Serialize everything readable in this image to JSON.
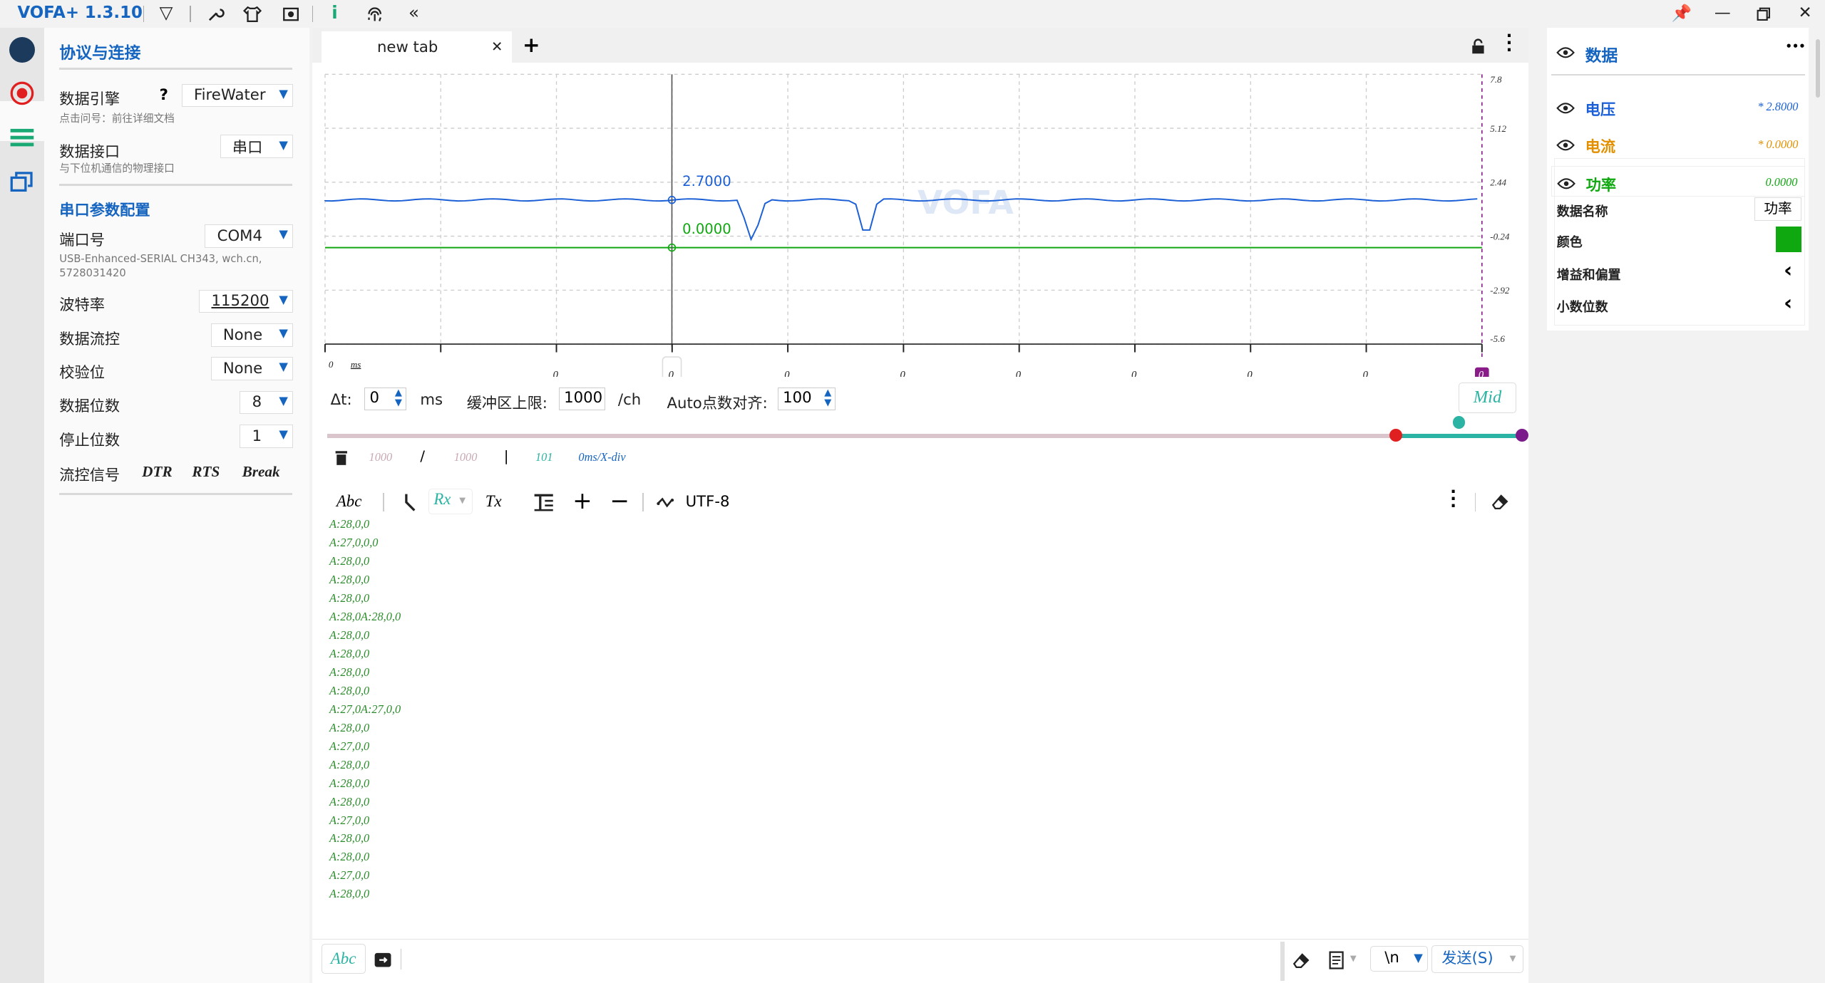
{
  "app": {
    "title": "VOFA+ 1.3.10"
  },
  "config": {
    "header": "协议与连接",
    "engine_label": "数据引擎",
    "engine_help": "?",
    "engine_value": "FireWater",
    "engine_hint": "点击问号：前往详细文档",
    "iface_label": "数据接口",
    "iface_value": "串口",
    "iface_hint": "与下位机通信的物理接口",
    "serial_section": "串口参数配置",
    "port_label": "端口号",
    "port_value": "COM4",
    "port_desc_1": "USB-Enhanced-SERIAL CH343, wch.cn,",
    "port_desc_2": "5728031420",
    "baud_label": "波特率",
    "baud_value": "115200",
    "flow_label": "数据流控",
    "flow_value": "None",
    "parity_label": "校验位",
    "parity_value": "None",
    "databits_label": "数据位数",
    "databits_value": "8",
    "stopbits_label": "停止位数",
    "stopbits_value": "1",
    "signal_label": "流控信号",
    "dtr": "DTR",
    "rts": "RTS",
    "break": "Break"
  },
  "tabs": {
    "active": "new tab",
    "close": "✕",
    "add": "+"
  },
  "plot": {
    "y_ticks": [
      "7.8",
      "5.12",
      "2.44",
      "-0.24",
      "-2.92",
      "-5.6"
    ],
    "x_origin": "0",
    "x_unit": "ms",
    "x_labels": [
      "0",
      "0",
      "0",
      "0",
      "0",
      "0",
      "0",
      "0",
      "0"
    ],
    "x_sub": "0",
    "cursor_value": "0",
    "marker_label": "0",
    "cursor_blue_value": "2.7000",
    "cursor_green_value": "0.0000",
    "watermark": "VOFA",
    "series_colors": {
      "voltage": "#1a5fd6",
      "current": "#e29000",
      "power": "#10a810"
    }
  },
  "controls": {
    "dt_label": "Δt:",
    "dt_value": "0",
    "dt_unit": "ms",
    "buffer_label": "缓冲区上限:",
    "buffer_value": "1000",
    "buffer_unit": "/ch",
    "auto_label": "Auto点数对齐:",
    "auto_value": "100",
    "mid_label": "Mid"
  },
  "status": {
    "count_a": "1000",
    "slash": "/",
    "count_b": "1000",
    "bar": "|",
    "count_c": "101",
    "div": "0ms/X-div"
  },
  "rx_toolbar": {
    "abc": "Abc",
    "rx": "Rx",
    "tx": "Tx",
    "encoding": "UTF-8"
  },
  "rx_lines": [
    "A:28,0,0",
    "A:27,0,0,0",
    "A:28,0,0",
    "A:28,0,0",
    "A:28,0,0",
    "A:28,0A:28,0,0",
    "A:28,0,0",
    "A:28,0,0",
    "A:28,0,0",
    "A:28,0,0",
    "A:27,0A:27,0,0",
    "A:28,0,0",
    "A:27,0,0",
    "A:28,0,0",
    "A:28,0,0",
    "A:28,0,0",
    "A:27,0,0",
    "A:28,0,0",
    "A:28,0,0",
    "A:27,0,0",
    "A:28,0,0"
  ],
  "send": {
    "abc": "Abc",
    "newline": "\\n",
    "send_label": "发送(S)"
  },
  "data_panel": {
    "header": "数据",
    "more": "•••",
    "channels": [
      {
        "name": "电压",
        "value": "* 2.8000",
        "color": "#1a5fd6"
      },
      {
        "name": "电流",
        "value": "* 0.0000",
        "color": "#e29000"
      },
      {
        "name": "功率",
        "value": "0.0000",
        "color": "#10a810"
      }
    ],
    "prop_name_label": "数据名称",
    "prop_name_value": "功率",
    "prop_color_label": "颜色",
    "prop_color_value": "#10a810",
    "prop_gain_label": "增益和偏置",
    "prop_decimal_label": "小数位数"
  }
}
